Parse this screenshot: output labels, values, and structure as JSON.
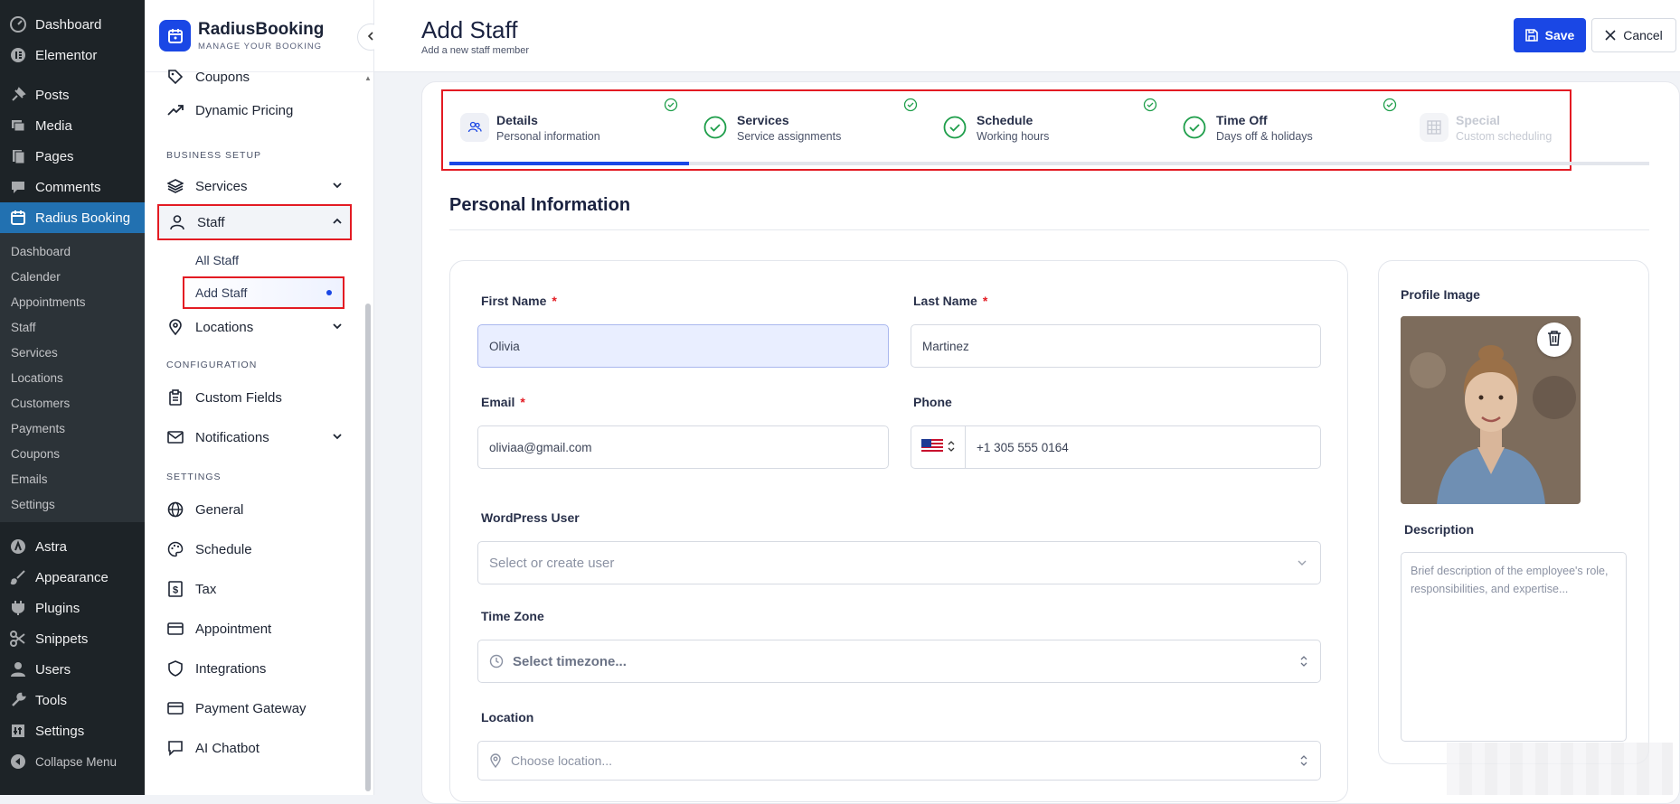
{
  "wp_menu": {
    "top": [
      {
        "label": "Dashboard",
        "icon": "dashboard-icon"
      },
      {
        "label": "Elementor",
        "icon": "elementor-icon"
      }
    ],
    "mid": [
      {
        "label": "Posts",
        "icon": "pin-icon"
      },
      {
        "label": "Media",
        "icon": "media-icon"
      },
      {
        "label": "Pages",
        "icon": "pages-icon"
      },
      {
        "label": "Comments",
        "icon": "comment-icon"
      }
    ],
    "active": {
      "label": "Radius Booking",
      "icon": "calendar-icon"
    },
    "submenu": [
      "Dashboard",
      "Calender",
      "Appointments",
      "Staff",
      "Services",
      "Locations",
      "Customers",
      "Payments",
      "Coupons",
      "Emails",
      "Settings"
    ],
    "bottom": [
      {
        "label": "Astra",
        "icon": "astra-icon"
      },
      {
        "label": "Appearance",
        "icon": "brush-icon"
      },
      {
        "label": "Plugins",
        "icon": "plugin-icon"
      },
      {
        "label": "Snippets",
        "icon": "scissors-icon"
      },
      {
        "label": "Users",
        "icon": "user-icon"
      },
      {
        "label": "Tools",
        "icon": "wrench-icon"
      },
      {
        "label": "Settings",
        "icon": "settings-icon"
      }
    ],
    "collapse": "Collapse Menu"
  },
  "brand": {
    "name": "RadiusBooking",
    "tagline": "MANAGE YOUR BOOKING"
  },
  "plugin_nav": {
    "coupons": "Coupons",
    "dynamic_pricing": "Dynamic Pricing",
    "business_setup": "BUSINESS SETUP",
    "services": "Services",
    "staff": "Staff",
    "all_staff": "All Staff",
    "add_staff": "Add Staff",
    "locations": "Locations",
    "configuration": "CONFIGURATION",
    "custom_fields": "Custom Fields",
    "notifications": "Notifications",
    "settings": "SETTINGS",
    "general": "General",
    "schedule": "Schedule",
    "tax": "Tax",
    "appointment": "Appointment",
    "integrations": "Integrations",
    "payment_gateway": "Payment Gateway",
    "ai_chatbot": "AI Chatbot"
  },
  "header": {
    "title": "Add Staff",
    "subtitle": "Add a new staff member",
    "save": "Save",
    "cancel": "Cancel"
  },
  "steps": [
    {
      "title": "Details",
      "sub": "Personal information"
    },
    {
      "title": "Services",
      "sub": "Service assignments"
    },
    {
      "title": "Schedule",
      "sub": "Working hours"
    },
    {
      "title": "Time Off",
      "sub": "Days off & holidays"
    },
    {
      "title": "Special",
      "sub": "Custom scheduling"
    }
  ],
  "section_title": "Personal Information",
  "form": {
    "first_name_label": "First Name",
    "first_name_value": "Olivia",
    "last_name_label": "Last Name",
    "last_name_value": "Martinez",
    "email_label": "Email",
    "email_value": "oliviaa@gmail.com",
    "phone_label": "Phone",
    "phone_value": "+1 305 555 0164",
    "wp_user_label": "WordPress User",
    "wp_user_placeholder": "Select or create user",
    "timezone_label": "Time Zone",
    "timezone_placeholder": "Select timezone...",
    "location_label": "Location",
    "location_placeholder": "Choose location...",
    "required_mark": "*"
  },
  "profile": {
    "image_label": "Profile Image",
    "description_label": "Description",
    "description_placeholder": "Brief description of the employee's role, responsibilities, and expertise..."
  },
  "colors": {
    "accent": "#1a47e5",
    "highlight": "#e31b23",
    "success": "#1e9e4a",
    "wp_active": "#2271b1"
  }
}
